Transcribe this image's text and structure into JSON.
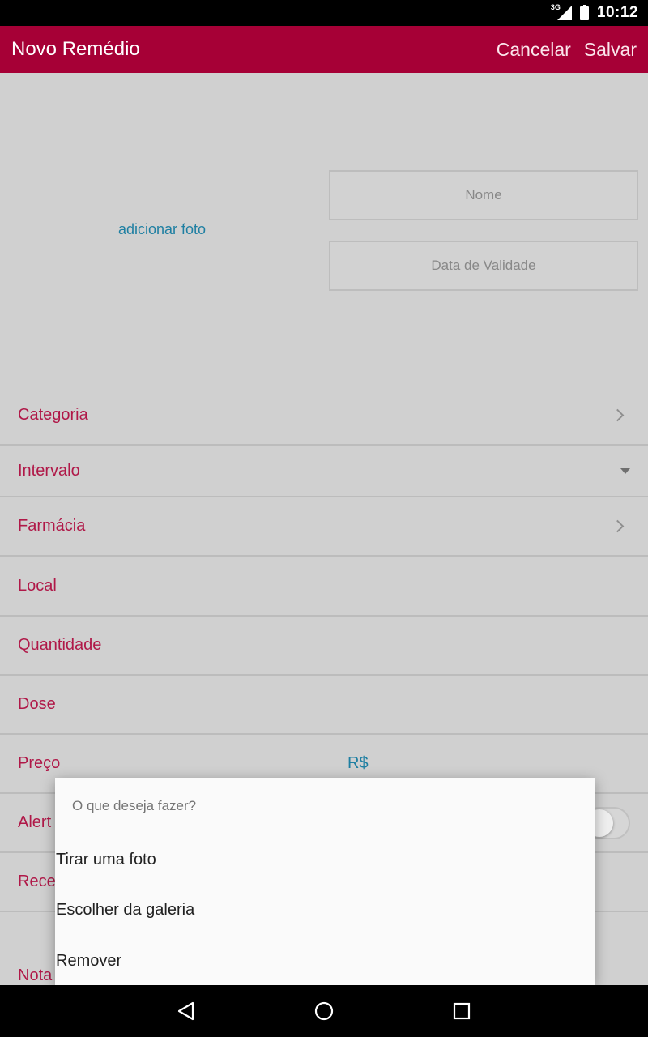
{
  "status_bar": {
    "network_label": "3G",
    "network_icon": "signal-icon",
    "battery_icon": "battery-charging-icon",
    "time": "10:12"
  },
  "app_bar": {
    "title": "Novo Remédio",
    "cancel_label": "Cancelar",
    "save_label": "Salvar",
    "color": "#a60036"
  },
  "photo": {
    "add_photo_label": "adicionar foto",
    "name_placeholder": "Nome",
    "validity_placeholder": "Data de Validade"
  },
  "form": {
    "categoria": "Categoria",
    "intervalo": "Intervalo",
    "farmacia": "Farmácia",
    "local": "Local",
    "quantidade": "Quantidade",
    "dose": "Dose",
    "preco": "Preço",
    "preco_currency": "R$",
    "alerta": "Alert",
    "receita": "Rece",
    "nota": "Nota",
    "label_color": "#b01848"
  },
  "dialog": {
    "title": "O que deseja fazer?",
    "options": [
      "Tirar uma foto",
      "Escolher da galeria",
      "Remover"
    ]
  },
  "nav_bar": {
    "back_icon": "back-triangle-icon",
    "home_icon": "home-circle-icon",
    "recents_icon": "recents-square-icon"
  }
}
